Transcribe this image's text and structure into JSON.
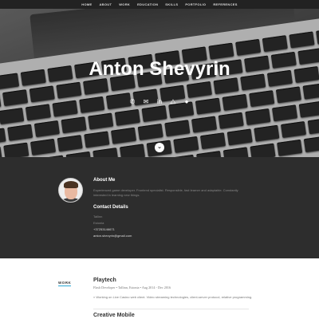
{
  "nav": {
    "items": [
      "HOME",
      "ABOUT",
      "WORK",
      "EDUCATION",
      "SKILLS",
      "PORTFOLIO",
      "REFERENCES"
    ]
  },
  "hero": {
    "title": "Anton Shevyrin",
    "social_icons": [
      "phone-icon",
      "email-icon",
      "linkedin-icon",
      "game-icon",
      "github-icon"
    ],
    "social_glyphs": [
      "✆",
      "✉",
      "in",
      "⧍",
      "●"
    ],
    "scroll_glyph": "⌄"
  },
  "about": {
    "heading": "About Me",
    "description": "Experienced game developer. Frontend specialist. Responsible, fast learner and adaptable. Constantly interested in learning new things.",
    "contact_heading": "Contact Details",
    "city": "Tallinn",
    "country": "Estonia",
    "phone": "+37253146671",
    "email": "anton.shevyrin@gmail.com"
  },
  "work": {
    "label": "WORK",
    "company": "Playtech",
    "meta": "Flash Developer  •  Tallinn, Estonia  •  Aug 2014 - Dec 2016",
    "description": "» Working on Live Casino web client. Video streaming technologies, client-server protocol, relative programming.",
    "next_company": "Creative Mobile"
  },
  "colors": {
    "accent": "#2aa8d5",
    "nav_bg": "#222222",
    "about_bg": "#2d2d2d"
  }
}
